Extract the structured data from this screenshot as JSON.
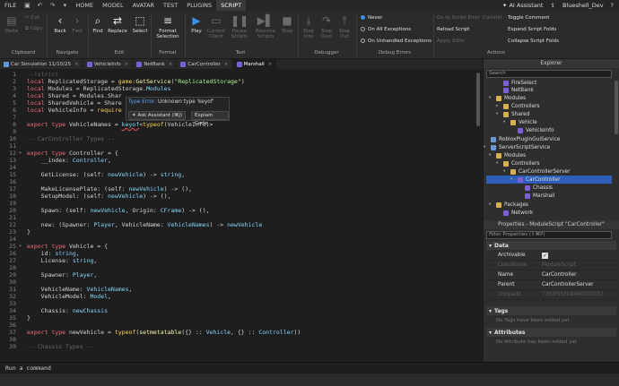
{
  "menubar": {
    "items": [
      "FILE",
      "HOME",
      "MODEL",
      "AVATAR",
      "TEST",
      "PLUGINS",
      "SCRIPT"
    ],
    "active": "SCRIPT",
    "ai_assistant": "AI Assistant",
    "user": "Blueshell_Dev"
  },
  "ribbon": {
    "clipboard": {
      "paste": "Paste",
      "cut": "Cut",
      "copy": "Copy",
      "label": "Clipboard"
    },
    "navigate": {
      "back": "Back",
      "fwd": "Fwd",
      "label": "Navigate"
    },
    "edit": {
      "find": "Find",
      "replace": "Replace",
      "select": "Select",
      "label": "Edit"
    },
    "format": {
      "format_selection": "Format Selection",
      "label": "Format"
    },
    "test": {
      "play": "Play",
      "current_client": "Current Client",
      "pause_scripts": "Pause Scripts",
      "resume_scripts": "Resume Scripts",
      "stop": "Stop",
      "label": "Test"
    },
    "debugger": {
      "step_into": "Step Into",
      "step_over": "Step Over",
      "step_out": "Step Out",
      "label": "Debugger"
    },
    "debug_errors": {
      "never": "Never",
      "all_exceptions": "On All Exceptions",
      "unhandled": "On Unhandled Exceptions",
      "label": "Debug Errors"
    },
    "actions": {
      "go_to_script_error": "Go to Script Error",
      "commit": "Commit",
      "reload_script": "Reload Script",
      "apply_edits": "Apply Edits",
      "toggle_comment": "Toggle Comment",
      "expand_folds": "Expand Script Folds",
      "collapse_folds": "Collapse Script Folds",
      "label": "Actions"
    }
  },
  "tabs": [
    {
      "label": "Car Simulation 11/10/25",
      "active": false
    },
    {
      "label": "VehicleInfo",
      "active": false
    },
    {
      "label": "NetBank",
      "active": false
    },
    {
      "label": "CarController",
      "active": false
    },
    {
      "label": "Marshall",
      "active": true
    }
  ],
  "editor": {
    "lines": [
      "1",
      "2",
      "3",
      "4",
      "5",
      "6",
      "7",
      "8",
      "9",
      "10",
      "11",
      "12",
      "13",
      "14",
      "15",
      "16",
      "17",
      "18",
      "19",
      "20",
      "21",
      "22",
      "23",
      "24",
      "25",
      "26",
      "27",
      "28",
      "29",
      "30",
      "31",
      "32",
      "33",
      "34",
      "35",
      "36",
      "37",
      "38",
      "39"
    ]
  },
  "tooltip": {
    "error_label": "Type Error:",
    "error_message": "Unknown type 'keyof'",
    "ask_assistant": "Ask Assistant (⌘J)",
    "explain_code": "Explain Code"
  },
  "command_bar": {
    "placeholder": "Run a command"
  },
  "explorer": {
    "title": "Explorer",
    "search_placeholder": "Search",
    "items": [
      "FireSelect",
      "NetBank",
      "Modules",
      "Controllers",
      "Shared",
      "Vehicle",
      "VehicleInfo",
      "RobloxPluginGuiService",
      "ServerScriptService",
      "Modules",
      "Controllers",
      "CarControllerServer",
      "CarController",
      "Chassis",
      "Marshall",
      "Packages",
      "Network"
    ]
  },
  "properties": {
    "title": "Properties - ModuleScript \"CarController\"",
    "filter_placeholder": "Filter Properties (⇧⌘P)",
    "data_section": "Data",
    "rows": [
      {
        "key": "Archivable",
        "value": "",
        "dim": false
      },
      {
        "key": "ClassName",
        "value": "ModuleScript",
        "dim": true
      },
      {
        "key": "Name",
        "value": "CarController",
        "dim": false
      },
      {
        "key": "Parent",
        "value": "CarControllerServer",
        "dim": false
      },
      {
        "key": "UniqueId",
        "value": "7383f950b9460000032",
        "dim": true
      }
    ],
    "tags_section": "Tags",
    "tags_note": "No Tags have been added yet",
    "attributes_section": "Attributes",
    "attributes_note": "No Attribute has been added yet"
  },
  "colors": {
    "accent": "#3d8ee8",
    "selection": "#2d5fb8",
    "editor_bg": "#1e1e1e"
  }
}
